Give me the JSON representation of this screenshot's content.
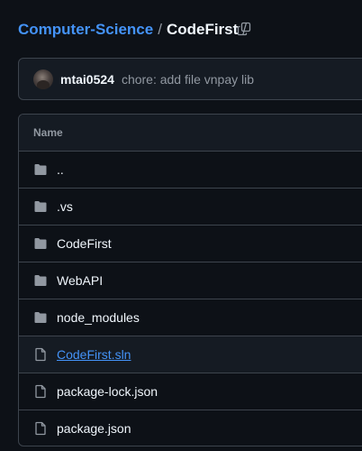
{
  "breadcrumb": {
    "repo": "Computer-Science",
    "separator": "/",
    "folder": "CodeFirst",
    "trailing_separator": "/",
    "copy_icon": "copy-icon"
  },
  "commit": {
    "author": "mtai0524",
    "message": "chore: add file vnpay lib"
  },
  "table": {
    "header": "Name",
    "rows": [
      {
        "label": "..",
        "icon": "folder-icon"
      },
      {
        "label": ".vs",
        "icon": "folder-icon"
      },
      {
        "label": "CodeFirst",
        "icon": "folder-icon"
      },
      {
        "label": "WebAPI",
        "icon": "folder-icon"
      },
      {
        "label": "node_modules",
        "icon": "folder-icon"
      },
      {
        "label": "CodeFirst.sln",
        "icon": "file-icon",
        "hovered": true
      },
      {
        "label": "package-lock.json",
        "icon": "file-icon"
      },
      {
        "label": "package.json",
        "icon": "file-icon"
      }
    ]
  },
  "colors": {
    "background": "#0d1117",
    "accent_link": "#4493f8",
    "border": "#3d444d",
    "muted_text": "#9198a1",
    "primary_text": "#f0f6fc"
  }
}
